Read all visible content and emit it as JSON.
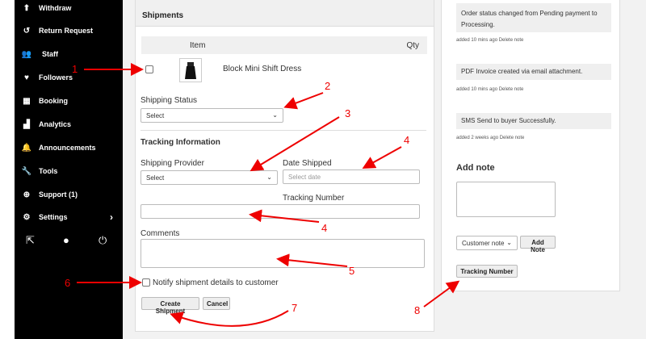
{
  "sidebar": {
    "items": [
      {
        "label": "Withdraw",
        "icon": "upload-icon"
      },
      {
        "label": "Return Request",
        "icon": "return-icon"
      },
      {
        "label": "Staff",
        "icon": "users-icon"
      },
      {
        "label": "Followers",
        "icon": "heart-icon"
      },
      {
        "label": "Booking",
        "icon": "calendar-icon"
      },
      {
        "label": "Analytics",
        "icon": "chart-icon"
      },
      {
        "label": "Announcements",
        "icon": "bell-icon"
      },
      {
        "label": "Tools",
        "icon": "wrench-icon"
      },
      {
        "label": "Support (1)",
        "icon": "lifebuoy-icon"
      },
      {
        "label": "Settings",
        "icon": "gear-icon"
      }
    ],
    "settings_chevron": "›",
    "bottom_icons": [
      "external-link-icon",
      "user-icon",
      "power-icon"
    ]
  },
  "shipments": {
    "title": "Shipments",
    "table_headers": {
      "item": "Item",
      "qty": "Qty"
    },
    "product_name": "Block Mini Shift Dress",
    "shipping_status_label": "Shipping Status",
    "shipping_status_value": "Select",
    "tracking_info_title": "Tracking Information",
    "shipping_provider_label": "Shipping Provider",
    "shipping_provider_value": "Select",
    "date_shipped_label": "Date Shipped",
    "date_shipped_placeholder": "Select date",
    "tracking_number_label": "Tracking Number",
    "comments_label": "Comments",
    "notify_label": "Notify shipment details to customer",
    "create_button": "Create Shipment",
    "cancel_button": "Cancel"
  },
  "notes": {
    "items": [
      {
        "text": "Order status changed from Pending payment to Processing.",
        "meta": "added 10 mins ago Delete note"
      },
      {
        "text": "PDF Invoice created via email attachment.",
        "meta": "added 10 mins ago Delete note"
      },
      {
        "text": "SMS Send to buyer Successfully.",
        "meta": "added 2 weeks ago Delete note"
      }
    ],
    "add_note_title": "Add note",
    "note_type_value": "Customer note",
    "add_note_button": "Add Note",
    "tracking_number_button": "Tracking Number"
  },
  "annotations": [
    "1",
    "2",
    "3",
    "4",
    "4",
    "5",
    "6",
    "7",
    "8"
  ],
  "colors": {
    "annotation": "#e00000",
    "sidebar": "#000000"
  }
}
